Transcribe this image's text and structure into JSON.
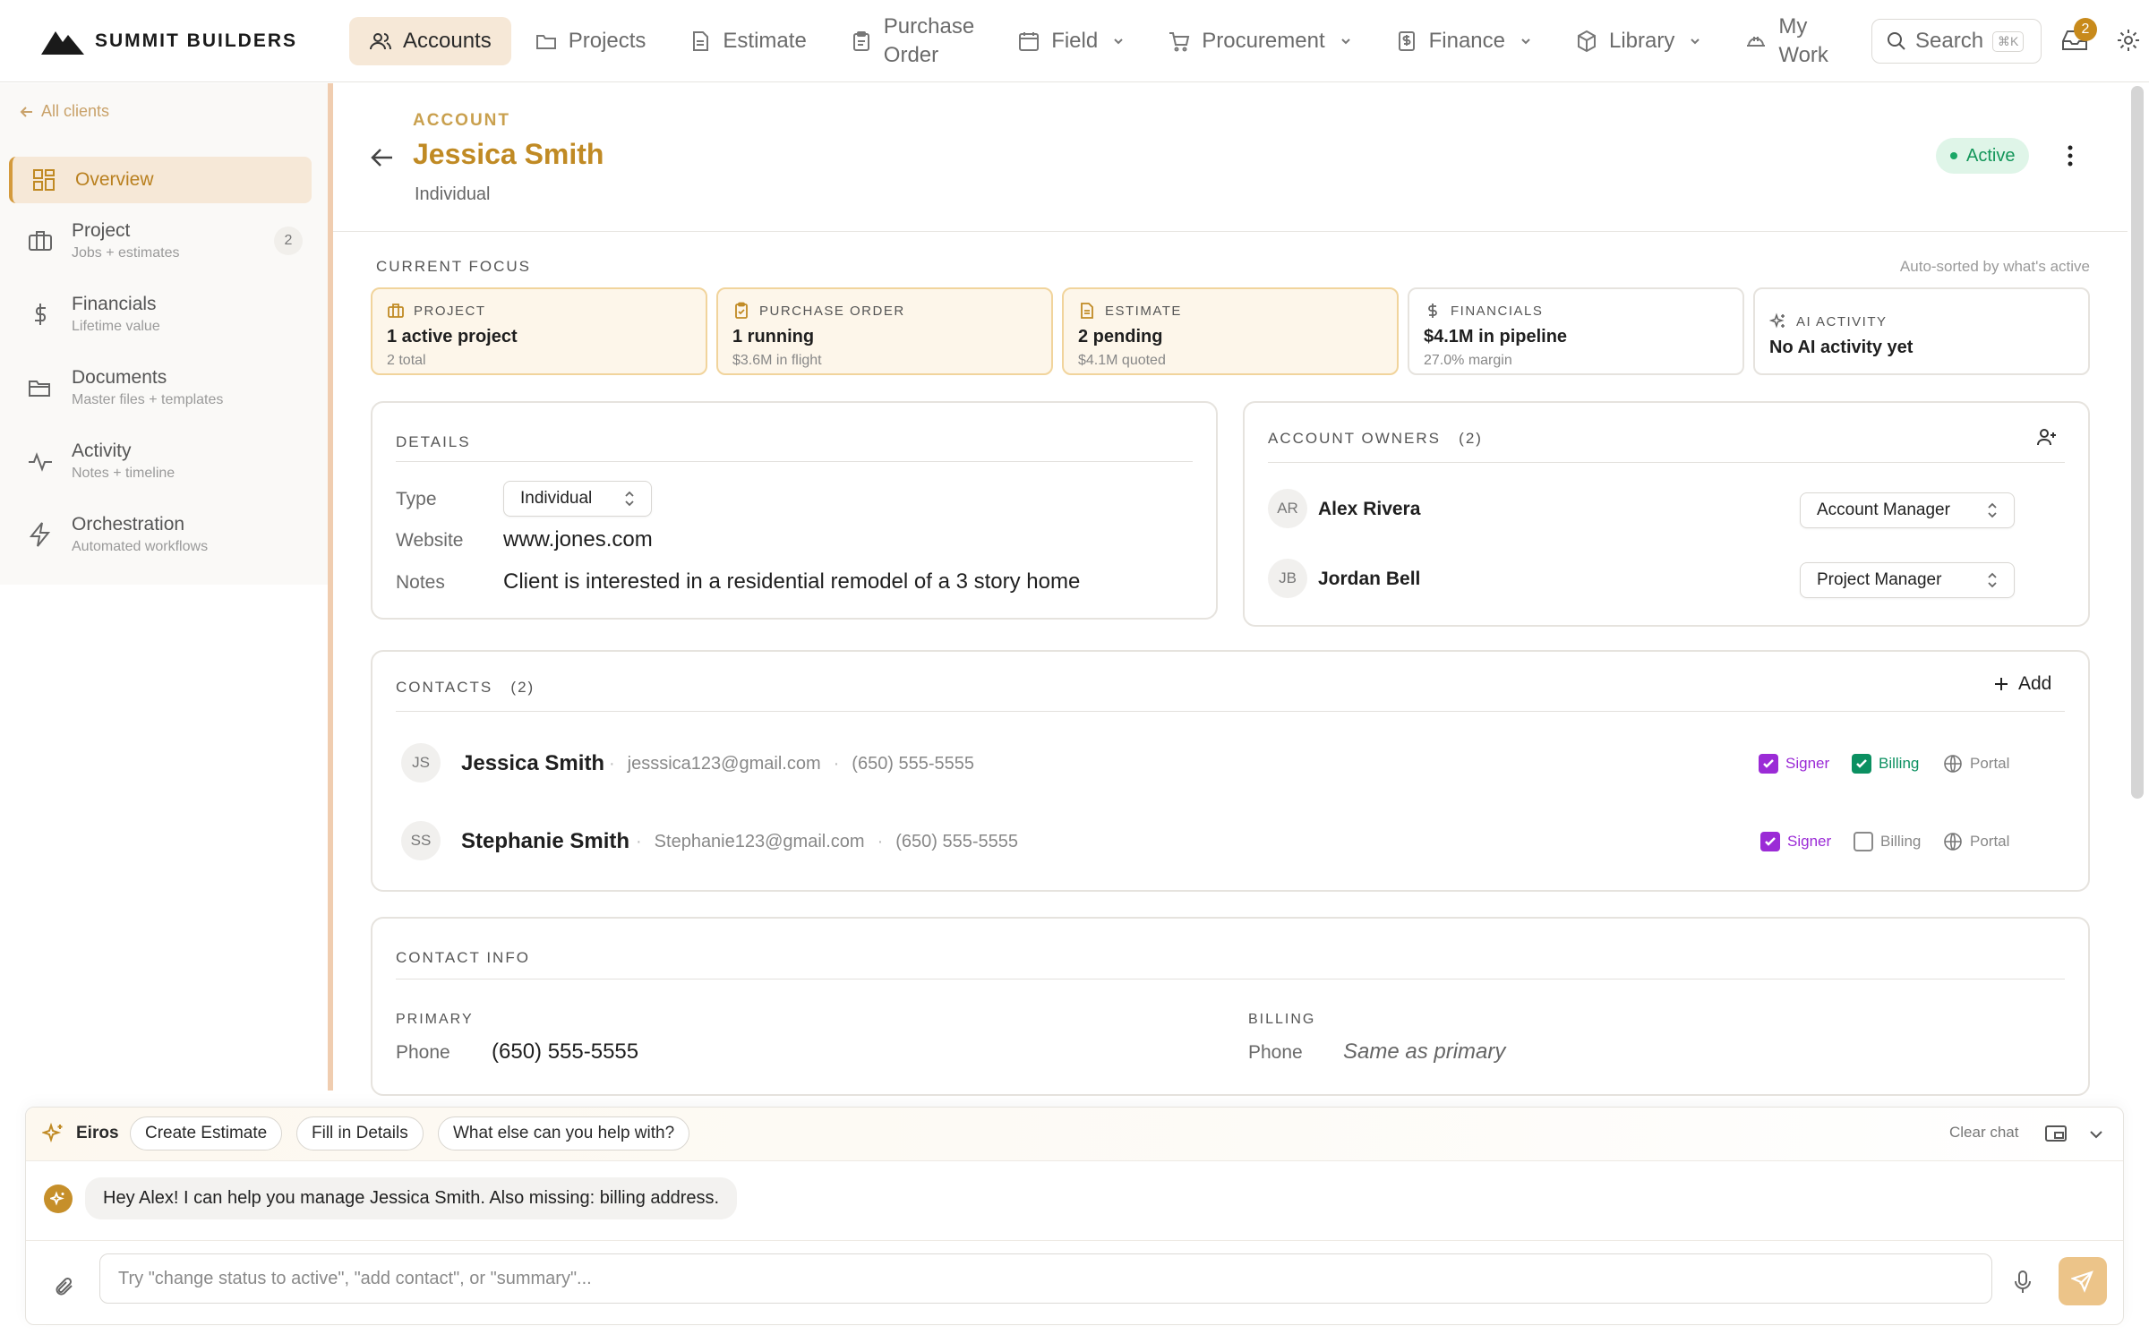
{
  "brand": {
    "name": "SUMMIT BUILDERS"
  },
  "nav": {
    "items": [
      {
        "label": "Accounts",
        "icon": "users-icon",
        "active": true
      },
      {
        "label": "Projects",
        "icon": "folder-icon"
      },
      {
        "label": "Estimate",
        "icon": "document-icon"
      },
      {
        "label_line1": "Purchase",
        "label_line2": "Order",
        "icon": "clipboard-icon"
      },
      {
        "label": "Field",
        "icon": "calendar-icon",
        "dropdown": true
      },
      {
        "label": "Procurement",
        "icon": "cart-icon",
        "dropdown": true
      },
      {
        "label": "Finance",
        "icon": "dollar-doc-icon",
        "dropdown": true
      },
      {
        "label": "Library",
        "icon": "cube-icon",
        "dropdown": true
      },
      {
        "label_line1": "My",
        "label_line2": "Work",
        "icon": "hardhat-icon"
      }
    ],
    "search_label": "Search",
    "search_shortcut": "⌘K",
    "inbox_count": "2"
  },
  "sidebar": {
    "back_label": "All clients",
    "items": [
      {
        "title": "Overview",
        "icon": "grid-icon",
        "active": true
      },
      {
        "title": "Project",
        "subtitle": "Jobs + estimates",
        "count": "2",
        "icon": "briefcase-icon"
      },
      {
        "title": "Financials",
        "subtitle": "Lifetime value",
        "icon": "dollar-icon"
      },
      {
        "title": "Documents",
        "subtitle": "Master files + templates",
        "icon": "folder-open-icon"
      },
      {
        "title": "Activity",
        "subtitle": "Notes + timeline",
        "icon": "activity-icon"
      },
      {
        "title": "Orchestration",
        "subtitle": "Automated workflows",
        "icon": "bolt-icon"
      }
    ]
  },
  "account": {
    "eyebrow": "ACCOUNT",
    "name": "Jessica Smith",
    "type": "Individual",
    "status": "Active"
  },
  "focus": {
    "label": "CURRENT FOCUS",
    "note": "Auto-sorted by what's active",
    "cards": [
      {
        "head": "PROJECT",
        "main": "1 active project",
        "sub": "2 total"
      },
      {
        "head": "PURCHASE ORDER",
        "main": "1 running",
        "sub": "$3.6M in flight"
      },
      {
        "head": "ESTIMATE",
        "main": "2 pending",
        "sub": "$4.1M quoted"
      },
      {
        "head": "FINANCIALS",
        "main": "$4.1M in pipeline",
        "sub": "27.0% margin"
      },
      {
        "head": "AI ACTIVITY",
        "main": "No AI activity yet"
      }
    ]
  },
  "details": {
    "label": "DETAILS",
    "type_label": "Type",
    "type_value": "Individual",
    "website_label": "Website",
    "website_value": "www.jones.com",
    "notes_label": "Notes",
    "notes_value": "Client is interested in a residential remodel of a 3 story home"
  },
  "owners": {
    "label": "ACCOUNT OWNERS",
    "count": "(2)",
    "list": [
      {
        "initials": "AR",
        "name": "Alex Rivera",
        "role": "Account Manager"
      },
      {
        "initials": "JB",
        "name": "Jordan Bell",
        "role": "Project Manager"
      }
    ]
  },
  "contacts": {
    "label": "CONTACTS",
    "count": "(2)",
    "add_label": "Add",
    "list": [
      {
        "initials": "JS",
        "name": "Jessica Smith",
        "email": "jesssica123@gmail.com",
        "phone": "(650) 555-5555",
        "signer": true,
        "billing": true
      },
      {
        "initials": "SS",
        "name": "Stephanie Smith",
        "email": "Stephanie123@gmail.com",
        "phone": "(650) 555-5555",
        "signer": true,
        "billing": false
      }
    ],
    "signer_label": "Signer",
    "billing_label": "Billing",
    "portal_label": "Portal"
  },
  "contact_info": {
    "label": "CONTACT INFO",
    "primary_label": "PRIMARY",
    "primary_phone_label": "Phone",
    "primary_phone": "(650) 555-5555",
    "billing_label": "BILLING",
    "billing_phone_label": "Phone",
    "billing_phone": "Same as primary"
  },
  "chat": {
    "assistant_name": "Eiros",
    "chips": [
      "Create Estimate",
      "Fill in Details",
      "What else can you help with?"
    ],
    "clear_label": "Clear chat",
    "message": "Hey Alex! I can help you manage Jessica Smith. Also missing: billing address.",
    "placeholder": "Try \"change status to active\", \"add contact\", or \"summary\"..."
  },
  "colors": {
    "accent": "#c08a24",
    "accent_bg": "#f6e8d7",
    "active_green": "#14965a",
    "signer_purple": "#9b2bd6",
    "billing_green": "#0b9061"
  }
}
